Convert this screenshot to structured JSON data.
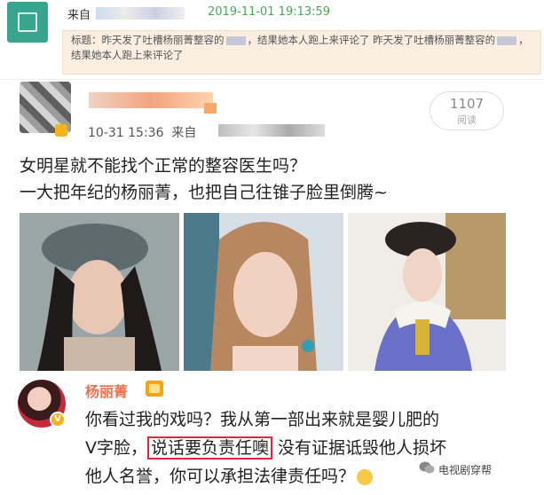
{
  "repost": {
    "from_label": "来自",
    "timestamp": "2019-11-01 19:13:59",
    "quote_prefix": "标题：",
    "quote_part1": "昨天发了吐槽杨丽菁整容的",
    "quote_part2": "，结果她本人跑上来评论了 昨天发了吐槽杨丽菁整容的",
    "quote_part3": "，结果她本人跑上来评论了"
  },
  "post": {
    "date": "10-31 15:36",
    "from_label": "来自",
    "read_count": "1107",
    "read_label": "阅读",
    "line1": "女明星就不能找个正常的整容医生吗？",
    "line2": "一大把年纪的杨丽菁，也把自己往锥子脸里倒腾~"
  },
  "reply": {
    "name": "杨丽菁",
    "verified_badge": "V",
    "line1": "你看过我的戏吗？我从第一部出来就是婴儿肥的",
    "line2_pre": "V字脸，",
    "line2_highlight": "说话要负责任噢",
    "line2_post": " 没有证据诋毁他人损坏",
    "line3": "他人名誉，你可以承担法律责任吗？"
  },
  "watermark": "电视剧穿帮",
  "colors": {
    "timestamp_green": "#4aa55a",
    "name_orange": "#eb7350",
    "highlight_red": "#e0283a",
    "quote_bg": "#fbefe2"
  },
  "icons": [
    "app-logo-icon",
    "verified-badge-icon",
    "crown-icon",
    "emoji-icon",
    "wechat-icon"
  ]
}
